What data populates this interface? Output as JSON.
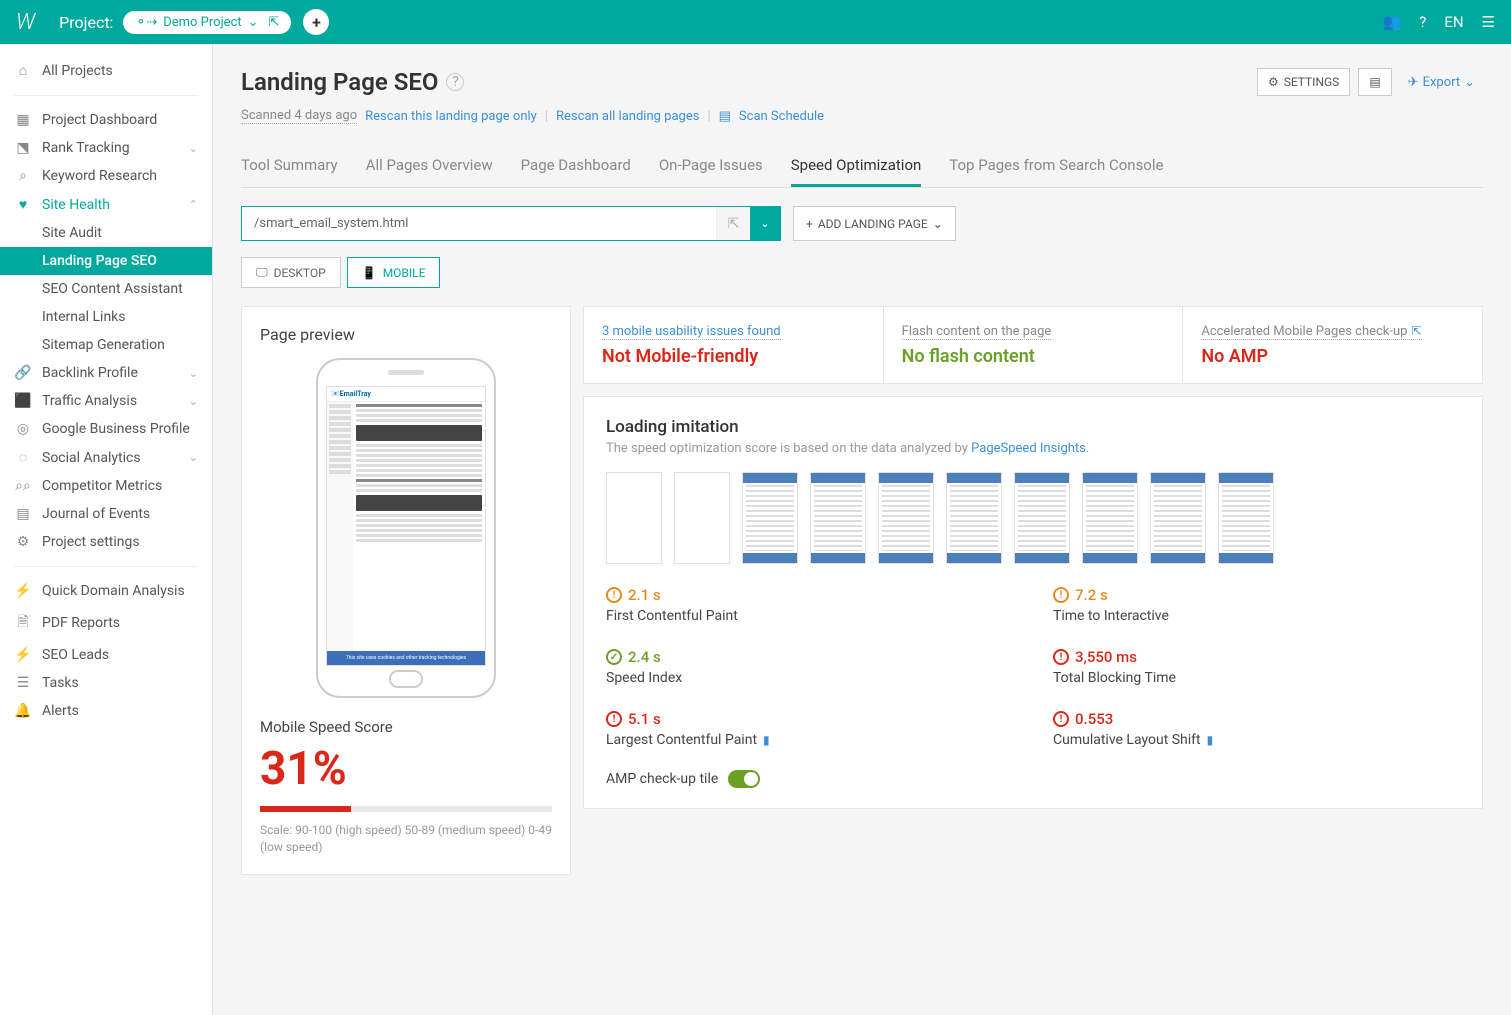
{
  "topbar": {
    "project_label": "Project:",
    "project_name": "Demo Project",
    "lang": "EN"
  },
  "sidebar": {
    "all_projects": "All Projects",
    "items": [
      {
        "label": "Project Dashboard",
        "icon": "📋"
      },
      {
        "label": "Rank Tracking",
        "icon": "📈",
        "expandable": true
      },
      {
        "label": "Keyword Research",
        "icon": "🔍"
      },
      {
        "label": "Site Health",
        "icon": "❤",
        "expandable": true,
        "active": true
      },
      {
        "label": "Backlink Profile",
        "icon": "🔗",
        "expandable": true
      },
      {
        "label": "Traffic Analysis",
        "icon": "📊",
        "expandable": true
      },
      {
        "label": "Google Business Profile",
        "icon": "📍"
      },
      {
        "label": "Social Analytics",
        "icon": "💬",
        "expandable": true
      },
      {
        "label": "Competitor Metrics",
        "icon": "🔭"
      },
      {
        "label": "Journal of Events",
        "icon": "📅"
      },
      {
        "label": "Project settings",
        "icon": "⚙"
      }
    ],
    "site_health_sub": [
      "Site Audit",
      "Landing Page SEO",
      "SEO Content Assistant",
      "Internal Links",
      "Sitemap Generation"
    ],
    "bottom": [
      {
        "label": "Quick Domain Analysis",
        "icon": "⚡"
      },
      {
        "label": "PDF Reports",
        "icon": "📄"
      },
      {
        "label": "SEO Leads",
        "icon": "⚡"
      },
      {
        "label": "Tasks",
        "icon": "☰"
      },
      {
        "label": "Alerts",
        "icon": "🔔"
      }
    ]
  },
  "page": {
    "title": "Landing Page SEO",
    "settings": "SETTINGS",
    "export": "Export",
    "scanned": "Scanned 4 days ago",
    "rescan_this": "Rescan this landing page only",
    "rescan_all": "Rescan all landing pages",
    "scan_schedule": "Scan Schedule"
  },
  "tabs": [
    "Tool Summary",
    "All Pages Overview",
    "Page Dashboard",
    "On-Page Issues",
    "Speed Optimization",
    "Top Pages from Search Console"
  ],
  "active_tab": "Speed Optimization",
  "url_input": "/smart_email_system.html",
  "add_landing": "ADD LANDING PAGE",
  "device": {
    "desktop": "DESKTOP",
    "mobile": "MOBILE"
  },
  "preview": {
    "title": "Page preview",
    "brand": "📧EmailTray",
    "cookie": "This site uses cookies and other tracking technologies",
    "score_label": "Mobile Speed Score",
    "score": "31%",
    "scale": "Scale: 90-100 (high speed) 50-89 (medium speed) 0-49 (low speed)"
  },
  "status": {
    "usability_link": "3 mobile usability issues found",
    "usability_main": "Not Mobile-friendly",
    "flash_link": "Flash content on the page",
    "flash_main": "No flash content",
    "amp_link": "Accelerated Mobile Pages check-up",
    "amp_main": "No AMP"
  },
  "loading": {
    "title": "Loading imitation",
    "sub_pre": "The speed optimization score is based on the data analyzed by ",
    "sub_link": "PageSpeed Insights",
    "metrics": [
      {
        "val": "2.1 s",
        "label": "First Contentful Paint",
        "status": "warn"
      },
      {
        "val": "7.2 s",
        "label": "Time to Interactive",
        "status": "warn"
      },
      {
        "val": "2.4 s",
        "label": "Speed Index",
        "status": "ok"
      },
      {
        "val": "3,550 ms",
        "label": "Total Blocking Time",
        "status": "bad"
      },
      {
        "val": "5.1 s",
        "label": "Largest Contentful Paint",
        "status": "bad",
        "bookmark": true
      },
      {
        "val": "0.553",
        "label": "Cumulative Layout Shift",
        "status": "bad",
        "bookmark": true
      }
    ],
    "amp_toggle": "AMP check-up tile"
  }
}
